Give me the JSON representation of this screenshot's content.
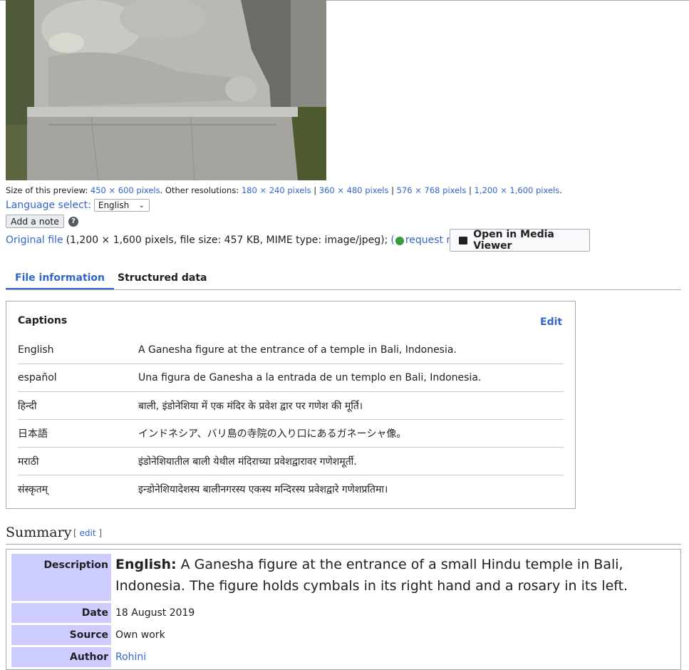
{
  "preview": {
    "size_label": "Size of this preview:",
    "size_link": "450 × 600 pixels",
    "other_label": ". Other resolutions:",
    "resolutions": [
      "180 × 240 pixels",
      "360 × 480 pixels",
      "576 × 768 pixels",
      "1,200 × 1,600 pixels"
    ],
    "separator": "|",
    "end": "."
  },
  "language": {
    "label": "Language select:",
    "selected": "English"
  },
  "note": {
    "add_label": "Add a note",
    "help": "?"
  },
  "original": {
    "link": "Original file",
    "details": "(1,200 × 1,600 pixels, file size: 457 KB, MIME type: image/jpeg);",
    "open_paren": "(",
    "rotation": "request rotation",
    "close_paren": ")"
  },
  "media_viewer": {
    "label": "Open in Media Viewer"
  },
  "tabs": [
    {
      "label": "File information"
    },
    {
      "label": "Structured data"
    }
  ],
  "captions": {
    "title": "Captions",
    "edit": "Edit",
    "rows": [
      {
        "lang": "English",
        "text": "A Ganesha figure at the entrance of a temple in Bali, Indonesia."
      },
      {
        "lang": "español",
        "text": "Una figura de Ganesha a la entrada de un templo en Bali, Indonesia."
      },
      {
        "lang": "हिन्दी",
        "text": "बाली, इंडोनेशिया में एक मंदिर के प्रवेश द्वार पर गणेश की मूर्ति।"
      },
      {
        "lang": "日本語",
        "text": "インドネシア、バリ島の寺院の入り口にあるガネーシャ像。"
      },
      {
        "lang": "मराठी",
        "text": "इंडोनेशियातील बाली येथील मंदिराच्या प्रवेशद्वारावर गणेशमूर्ती."
      },
      {
        "lang": "संस्कृतम्",
        "text": "इन्डोनेशियादेशस्य बालीनगरस्य एकस्य मन्दिरस्य प्रवेशद्वारे गणेशप्रतिमा।"
      }
    ]
  },
  "summary": {
    "heading": "Summary",
    "edit_open": "[",
    "edit": "edit",
    "edit_close": "]",
    "description_label": "Description",
    "description_lang": "English:",
    "description_text": "A Ganesha figure at the entrance of a small Hindu temple in Bali, Indonesia. The figure holds cymbals in its right hand and a rosary in its left.",
    "date_label": "Date",
    "date": "18 August 2019",
    "source_label": "Source",
    "source": "Own work",
    "author_label": "Author",
    "author": "Rohini"
  },
  "colors": {
    "link": "#3366cc",
    "label_bg": "#ccccff",
    "border": "#a2a9b1"
  }
}
